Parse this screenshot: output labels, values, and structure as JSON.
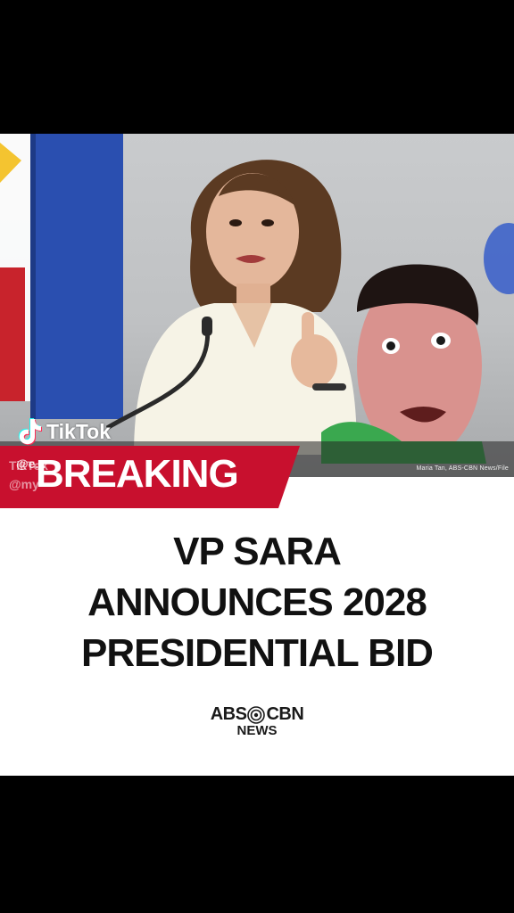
{
  "watermark": {
    "brand": "TikTok",
    "username": "@e...",
    "ghost_brand": "TikTok",
    "ghost_user": "@my"
  },
  "banner": {
    "label": "BREAKING"
  },
  "headline": {
    "line1": "VP SARA",
    "line2": "ANNOUNCES 2028",
    "line3": "PRESIDENTIAL BID"
  },
  "logo": {
    "main_left": "ABS",
    "main_right": "CBN",
    "sub": "NEWS"
  },
  "photo": {
    "credit": "Maria Tan, ABS-CBN News/File"
  },
  "colors": {
    "banner_red": "#c8102e",
    "accent_green": "#3aa84f"
  }
}
